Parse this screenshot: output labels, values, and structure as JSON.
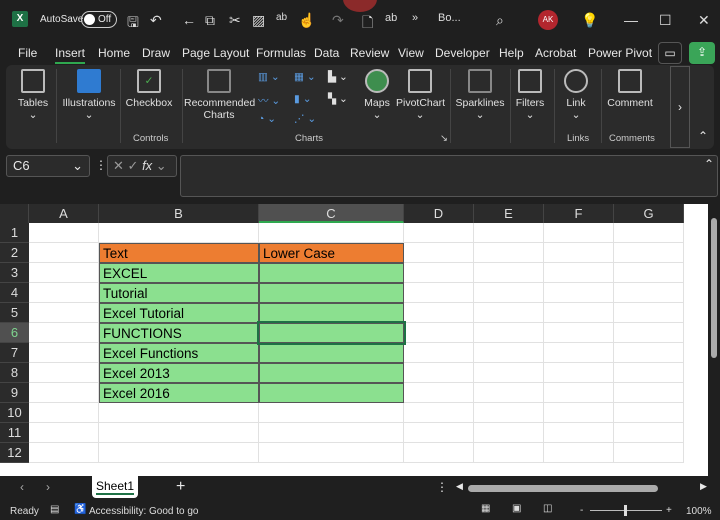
{
  "titlebar": {
    "autosave_label": "AutoSave",
    "autosave_state": "Off",
    "doc_title": "Bo...",
    "avatar": "AK",
    "overflow": "»"
  },
  "tabs": [
    "File",
    "Insert",
    "Home",
    "Draw",
    "Page Layout",
    "Formulas",
    "Data",
    "Review",
    "View",
    "Developer",
    "Help",
    "Acrobat",
    "Power Pivot"
  ],
  "active_tab": "Insert",
  "ribbon": {
    "tables": "Tables",
    "illustrations": "Illustrations",
    "checkbox": "Checkbox",
    "controls_group": "Controls",
    "recommended_charts_1": "Recommended",
    "recommended_charts_2": "Charts",
    "maps": "Maps",
    "pivotchart": "PivotChart",
    "charts_group": "Charts",
    "sparklines": "Sparklines",
    "filters": "Filters",
    "link": "Link",
    "links_group": "Links",
    "comment": "Comment",
    "comments_group": "Comments",
    "more": "›"
  },
  "formula_bar": {
    "name_box": "C6",
    "fx": "fx",
    "value": ""
  },
  "columns": [
    "A",
    "B",
    "C",
    "D",
    "E",
    "F",
    "G"
  ],
  "rows": [
    "1",
    "2",
    "3",
    "4",
    "5",
    "6",
    "7",
    "8",
    "9",
    "10",
    "11",
    "12"
  ],
  "table": {
    "headers": [
      "Text",
      "Lower Case"
    ],
    "rows": [
      [
        "EXCEL",
        ""
      ],
      [
        "Tutorial",
        ""
      ],
      [
        "Excel Tutorial",
        ""
      ],
      [
        "FUNCTIONS",
        ""
      ],
      [
        "Excel Functions",
        ""
      ],
      [
        "Excel 2013",
        ""
      ],
      [
        "Excel 2016",
        ""
      ]
    ]
  },
  "colors": {
    "header_fill": "#ED7D31",
    "data_fill": "#8BE08F",
    "accent": "#1E7145"
  },
  "sheets": [
    "Sheet1"
  ],
  "status": {
    "ready": "Ready",
    "accessibility": "Accessibility: Good to go",
    "zoom": "100%",
    "zoom_minus": "-",
    "zoom_plus": "+"
  }
}
